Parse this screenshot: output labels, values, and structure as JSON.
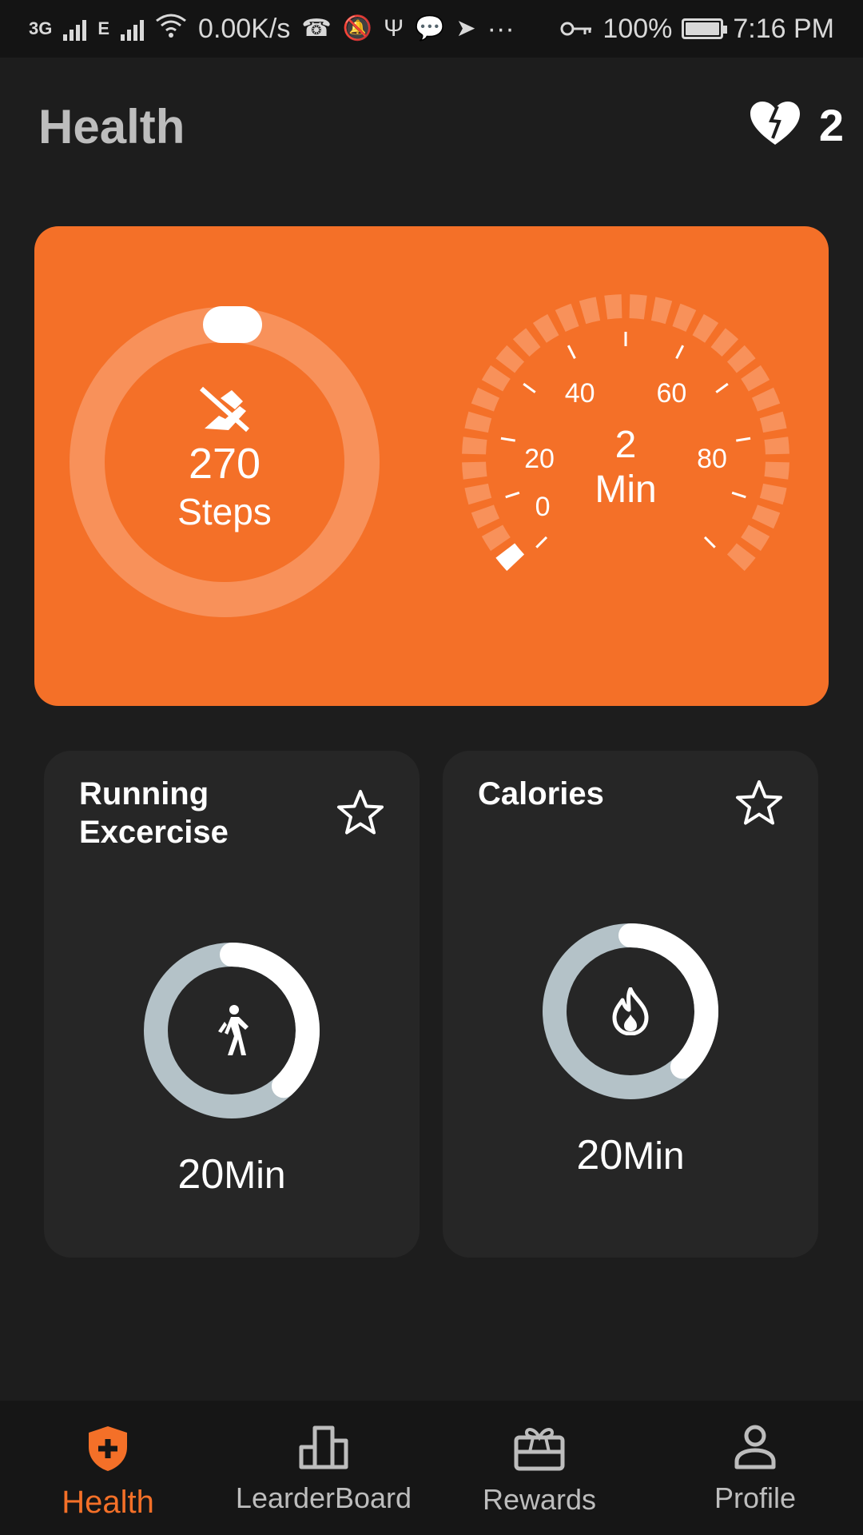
{
  "status_bar": {
    "net_3g": "3G",
    "net_e": "E",
    "speed": "0.00K/s",
    "more": "···",
    "battery": "100%",
    "time": "7:16 PM",
    "icons": [
      "signal-icon",
      "wifi-icon",
      "missed-call-icon",
      "notification-icon",
      "usb-icon",
      "chat-icon",
      "telegram-icon",
      "key-icon",
      "battery-icon"
    ]
  },
  "header": {
    "title": "Health",
    "lives_count": "2",
    "lives_icon": "broken-heart-icon"
  },
  "hero": {
    "steps_value": "270",
    "steps_label": "Steps",
    "steps_icon": "shoe-icon",
    "gauge_value": "2",
    "gauge_unit": "Min",
    "gauge_ticks": [
      "0",
      "20",
      "40",
      "60",
      "80"
    ],
    "gauge_level": 2,
    "gauge_max": 100
  },
  "cards": [
    {
      "title": "Running Excercise",
      "value": "20",
      "unit": "Min",
      "icon": "walking-icon",
      "progress": 0.38
    },
    {
      "title": "Calories",
      "value": "20",
      "unit": "Min",
      "icon": "fire-icon",
      "progress": 0.38
    }
  ],
  "nav": {
    "items": [
      {
        "label": "Health",
        "icon": "shield-plus-icon",
        "active": true
      },
      {
        "label": "LearderBoard",
        "icon": "leaderboard-icon",
        "active": false
      },
      {
        "label": "Rewards",
        "icon": "gift-card-icon",
        "active": false
      },
      {
        "label": "Profile",
        "icon": "person-icon",
        "active": false
      }
    ]
  },
  "colors": {
    "accent": "#f47028",
    "background": "#1d1d1d",
    "card": "#262626",
    "ring_track": "#b4c2c8"
  }
}
